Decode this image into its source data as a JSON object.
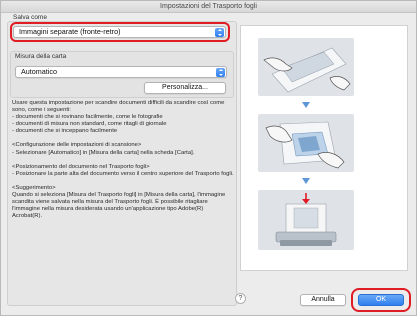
{
  "window": {
    "title": "Impostazioni del Trasporto fogli"
  },
  "save_as": {
    "label": "Salva come",
    "selected": "Immagini separate (fronte-retro)"
  },
  "paper_size": {
    "label": "Misura della carta",
    "selected": "Automatico",
    "customize_label": "Personalizza..."
  },
  "description": {
    "intro": "Usare questa impostazione per scandire documenti difficili da scandire così come sono, come i seguenti:",
    "bullets": [
      "- documenti che si rovinano facilmente, come le fotografie",
      "- documenti di misura non standard, come ritagli di giornale",
      "- documenti che si inceppano facilmente"
    ],
    "config_title": "<Configurazione delle impostazioni di scansione>",
    "config_text": "- Selezionare [Automatico] in [Misura della carta] nella scheda [Carta].",
    "position_title": "<Posizionamento del documento nel Trasporto fogli>",
    "position_text": "- Posizionare la parte alta del documento verso il centro superiore del Trasporto fogli.",
    "hint_title": "<Suggerimento>",
    "hint_text": "Quando si seleziona [Misura del Trasporto fogli] in [Misura della carta], l'immagine scandita viene salvata nella misura del Trasporto fogli. È possibile ritagliare l'immagine nella misura desiderata usando un'applicazione tipo Adobe(R) Acrobat(R)."
  },
  "footer": {
    "help_label": "?",
    "cancel_label": "Annulla",
    "ok_label": "OK"
  },
  "colors": {
    "highlight": "#e01c24",
    "accent": "#2f7ff0"
  }
}
